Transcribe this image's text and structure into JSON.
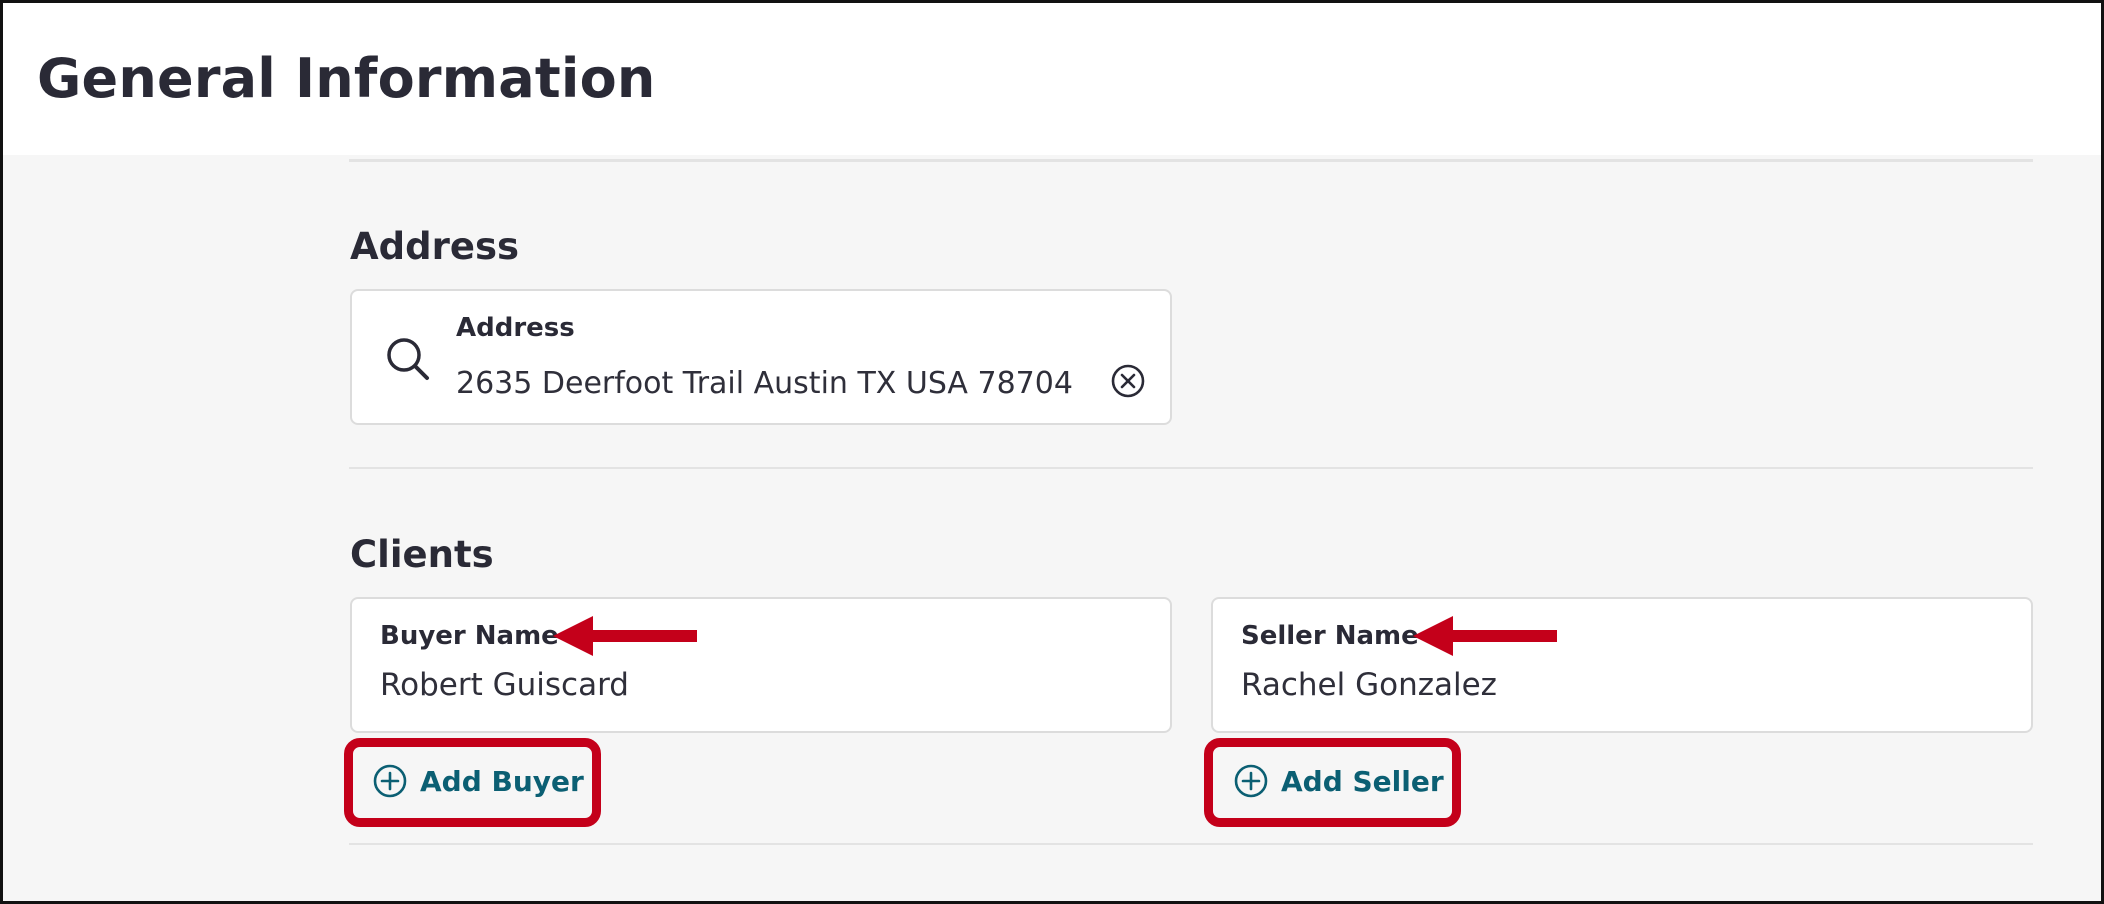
{
  "header": {
    "title": "General Information"
  },
  "address_section": {
    "heading": "Address",
    "field": {
      "label": "Address",
      "value": "2635 Deerfoot Trail Austin TX USA 78704",
      "search_icon": "search-icon",
      "clear_icon": "clear-circle-icon"
    }
  },
  "clients_section": {
    "heading": "Clients",
    "buyer": {
      "label": "Buyer Name",
      "value": "Robert Guiscard",
      "add_label": "Add Buyer",
      "add_icon": "plus-circle-icon"
    },
    "seller": {
      "label": "Seller Name",
      "value": "Rachel Gonzalez",
      "add_label": "Add Seller",
      "add_icon": "plus-circle-icon"
    }
  },
  "annotations": {
    "highlight_color": "#c4001a",
    "arrow_icon": "left-arrow-icon"
  },
  "colors": {
    "text_primary": "#2a2a36",
    "link_teal": "#0b5f73",
    "content_background": "#f6f6f6",
    "card_border": "#dcdcdc"
  }
}
